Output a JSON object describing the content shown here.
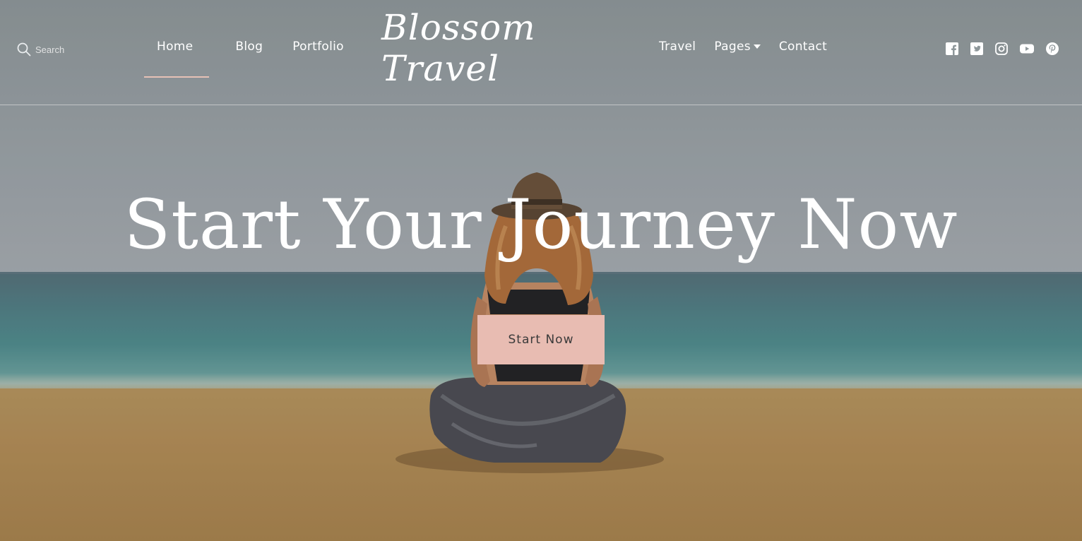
{
  "search": {
    "placeholder": "Search",
    "icon": "search-icon"
  },
  "nav": {
    "left": [
      {
        "label": "Home",
        "active": true
      },
      {
        "label": "Blog"
      },
      {
        "label": "Portfolio"
      }
    ],
    "right": [
      {
        "label": "Travel"
      },
      {
        "label": "Pages",
        "has_dropdown": true
      },
      {
        "label": "Contact"
      }
    ]
  },
  "logo": {
    "text": "Blossom Travel"
  },
  "social": [
    "facebook-icon",
    "twitter-icon",
    "instagram-icon",
    "youtube-icon",
    "pinterest-icon"
  ],
  "hero": {
    "title": "Start Your Journey Now",
    "cta_label": "Start Now"
  },
  "colors": {
    "accent": "#e8bcb2",
    "active_underline": "#e6c1b6",
    "text": "#ffffff"
  }
}
